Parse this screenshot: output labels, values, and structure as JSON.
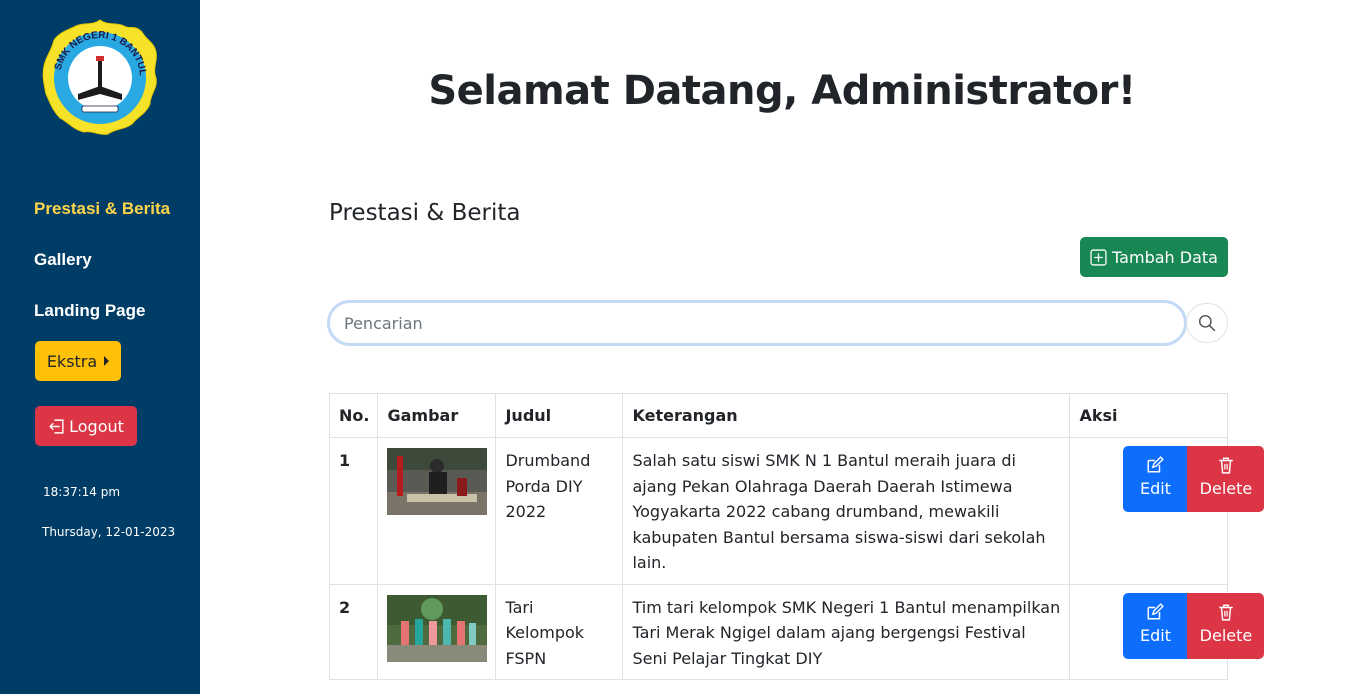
{
  "sidebar": {
    "logo_text": "SMK NEGERI 1 BANTUL",
    "nav": [
      {
        "label": "Prestasi & Berita",
        "active": true
      },
      {
        "label": "Gallery",
        "active": false
      },
      {
        "label": "Landing Page",
        "active": false
      }
    ],
    "ekstra_label": "Ekstra",
    "logout_label": "Logout",
    "time": "18:37:14 pm",
    "date": "Thursday, 12-01-2023"
  },
  "main": {
    "welcome": "Selamat Datang, Administrator!",
    "section_title": "Prestasi & Berita",
    "add_button_label": "Tambah Data",
    "search_placeholder": "Pencarian",
    "search_icon": "search-icon"
  },
  "table": {
    "headers": [
      "No.",
      "Gambar",
      "Judul",
      "Keterangan",
      "Aksi"
    ],
    "rows": [
      {
        "no": "1",
        "judul": "Drumband Porda DIY 2022",
        "keterangan": "Salah satu siswi SMK N 1 Bantul meraih juara di ajang Pekan Olahraga Daerah Daerah Istimewa Yogyakarta 2022 cabang drumband, mewakili kabupaten Bantul bersama siswa-siswi dari sekolah lain.",
        "edit_label": "Edit",
        "delete_label": "Delete"
      },
      {
        "no": "2",
        "judul": "Tari Kelompok FSPN",
        "keterangan": "Tim tari kelompok SMK Negeri 1 Bantul menampilkan Tari Merak Ngigel dalam ajang bergengsi Festival Seni Pelajar Tingkat DIY",
        "edit_label": "Edit",
        "delete_label": "Delete"
      }
    ]
  },
  "colors": {
    "sidebar_bg": "#003d66",
    "active_nav": "#ffd54a",
    "ekstra": "#ffc107",
    "logout": "#dc3545",
    "add": "#198754",
    "edit": "#0d6efd",
    "delete": "#dc3545"
  }
}
